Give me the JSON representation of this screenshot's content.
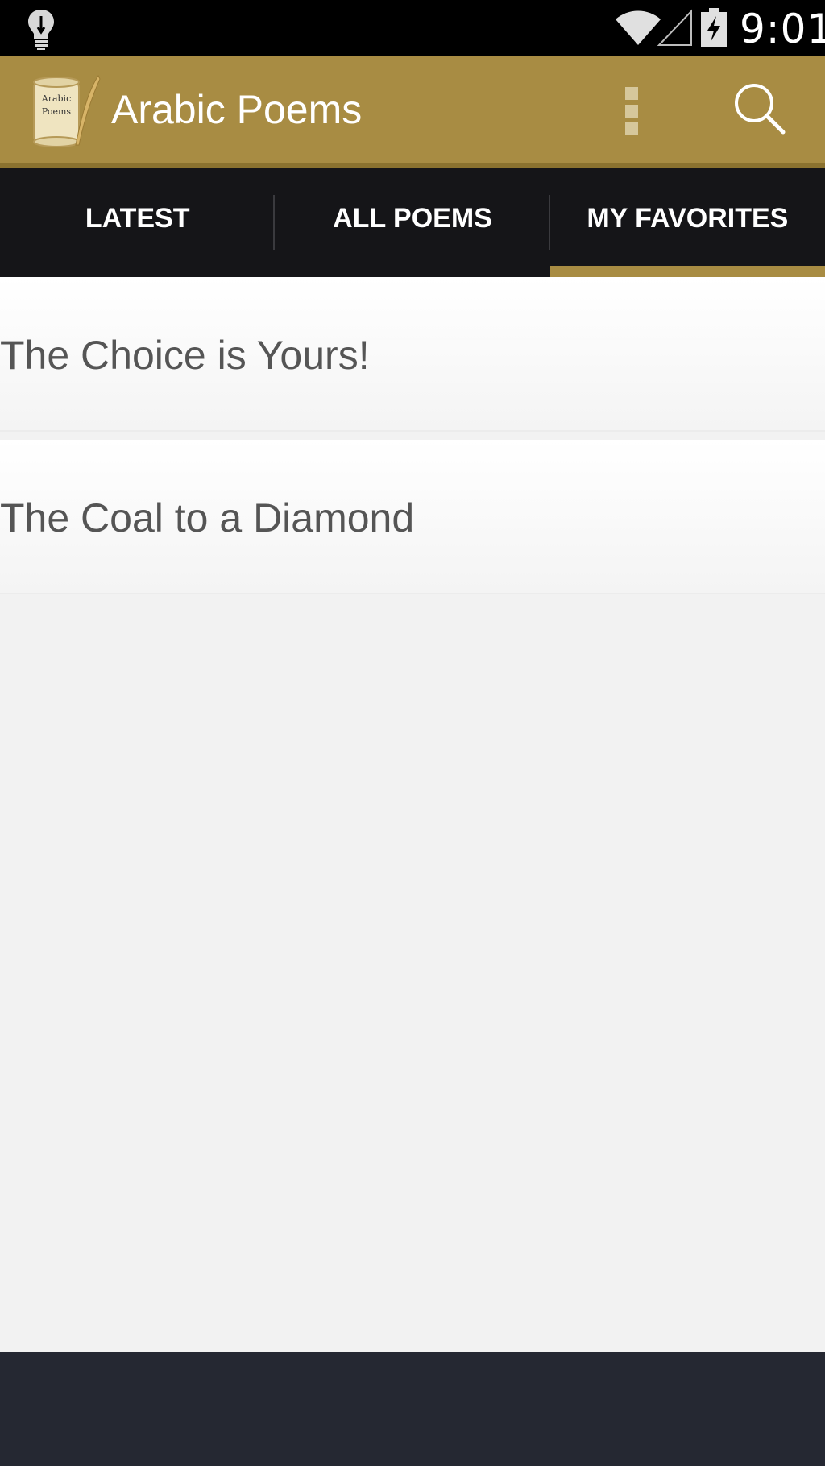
{
  "status_bar": {
    "time": "9:01",
    "icons": [
      "lightbulb-icon",
      "wifi-icon",
      "signal-icon",
      "battery-charging-icon"
    ]
  },
  "action_bar": {
    "title": "Arabic Poems",
    "logo": {
      "text_line1": "Arabic",
      "text_line2": "Poems"
    },
    "overflow_icon": "overflow-menu-icon",
    "search_icon": "search-icon"
  },
  "tabs": [
    {
      "label": "LATEST",
      "active": false
    },
    {
      "label": "ALL POEMS",
      "active": false
    },
    {
      "label": "MY FAVORITES",
      "active": true
    }
  ],
  "favorites": [
    {
      "title": "The Choice is Yours!"
    },
    {
      "title": "The Coal to a Diamond"
    }
  ],
  "colors": {
    "accent": "#a88c43",
    "tab_bar": "#151518",
    "bottom_bar": "#252832"
  }
}
